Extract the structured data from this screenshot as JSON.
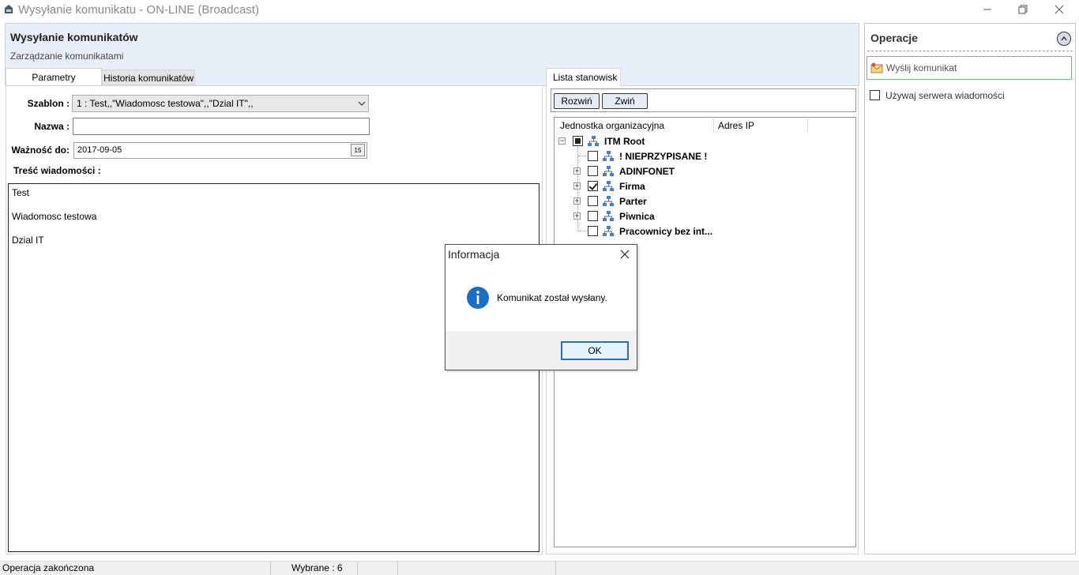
{
  "window": {
    "title": "Wysyłanie komunikatu - ON-LINE (Broadcast)",
    "minimize_icon": "minimize-icon",
    "restore_icon": "restore-icon",
    "close_icon": "close-icon"
  },
  "header": {
    "title": "Wysyłanie komunikatów",
    "subtitle": "Zarządzanie komunikatami"
  },
  "tabs": {
    "params": "Parametry",
    "history": "Historia komunikatów"
  },
  "form": {
    "szablon_label": "Szablon :",
    "szablon_value": "1 : Test,,\"Wiadomosc testowa\",,\"Dzial IT\",,",
    "nazwa_label": "Nazwa :",
    "nazwa_value": "",
    "waznosc_label": "Ważność do:",
    "waznosc_value": "2017-09-05",
    "calendar_glyph": "15",
    "tresc_label": "Treść wiadomości :",
    "message_lines": [
      "Test",
      "Wiadomosc testowa",
      "Dzial IT"
    ]
  },
  "stations": {
    "tab_label": "Lista stanowisk",
    "expand_button": "Rozwiń",
    "collapse_button": "Zwiń",
    "columns": [
      "Jednostka organizacyjna",
      "Adres IP"
    ],
    "tree": [
      {
        "label": "ITM Root",
        "level": 0,
        "expander": "−",
        "check": "partial"
      },
      {
        "label": "! NIEPRZYPISANE !",
        "level": 1,
        "expander": "",
        "check": "unchecked"
      },
      {
        "label": "ADINFONET",
        "level": 1,
        "expander": "+",
        "check": "unchecked"
      },
      {
        "label": "Firma",
        "level": 1,
        "expander": "+",
        "check": "checked"
      },
      {
        "label": "Parter",
        "level": 1,
        "expander": "+",
        "check": "unchecked"
      },
      {
        "label": "Piwnica",
        "level": 1,
        "expander": "+",
        "check": "unchecked"
      },
      {
        "label": "Pracownicy bez int...",
        "level": 1,
        "expander": "",
        "check": "unchecked"
      }
    ]
  },
  "operations": {
    "title": "Operacje",
    "send_button": "Wyślij komunikat",
    "use_server_label": "Używaj serwera wiadomości",
    "use_server_checked": false
  },
  "status": {
    "left": "Operacja zakończona",
    "selected": "Wybrane : 6"
  },
  "dialog": {
    "title": "Informacja",
    "message": "Komunikat został wysłany.",
    "ok_label": "OK",
    "icon": "info-icon"
  }
}
